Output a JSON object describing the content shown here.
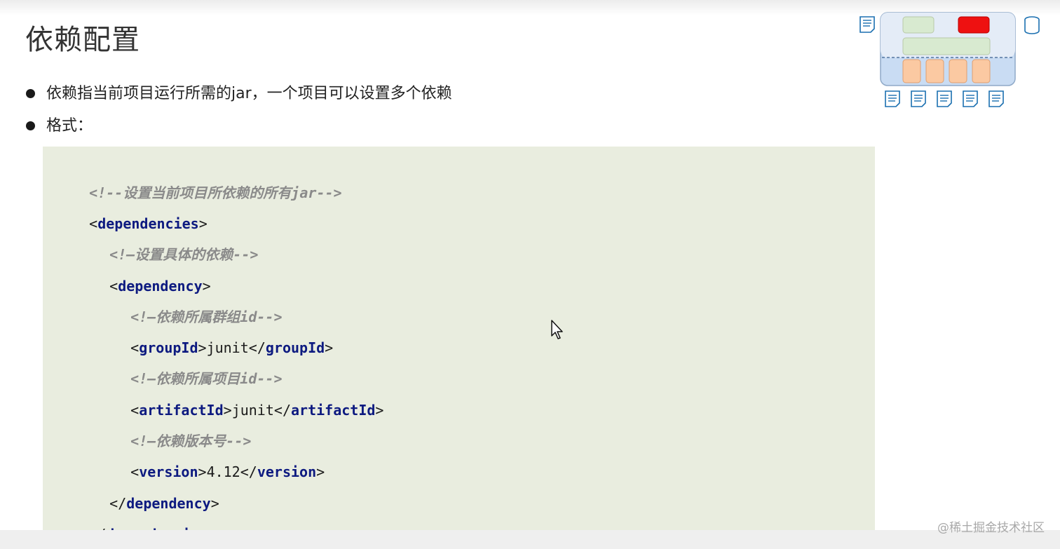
{
  "slide": {
    "title": "依赖配置",
    "bullets": [
      "依赖指当前项目运行所需的jar，一个项目可以设置多个依赖",
      "格式："
    ]
  },
  "code": {
    "comment_all": "<!--设置当前项目所依赖的所有jar-->",
    "dependencies_tag": "dependencies",
    "comment_dep": "<!–设置具体的依赖-->",
    "dependency_tag": "dependency",
    "comment_group": "<!–依赖所属群组id-->",
    "groupId_tag": "groupId",
    "groupId_value": "junit",
    "comment_artifact": "<!–依赖所属项目id-->",
    "artifactId_tag": "artifactId",
    "artifactId_value": "junit",
    "comment_version": "<!–依赖版本号-->",
    "version_tag": "version",
    "version_value": "4.12"
  },
  "watermark": "@稀土掘金技术社区",
  "colors": {
    "code_background": "#e9eddf",
    "tag_color": "#0d1a80",
    "comment_color": "#8a8a8a",
    "diagram_red": "#ee1111",
    "diagram_green": "#d8ead0",
    "diagram_orange": "#fbc9a2",
    "diagram_panel": "#c9dcf3"
  },
  "icons": [
    "document-icon",
    "database-icon",
    "mouse-pointer-icon"
  ]
}
